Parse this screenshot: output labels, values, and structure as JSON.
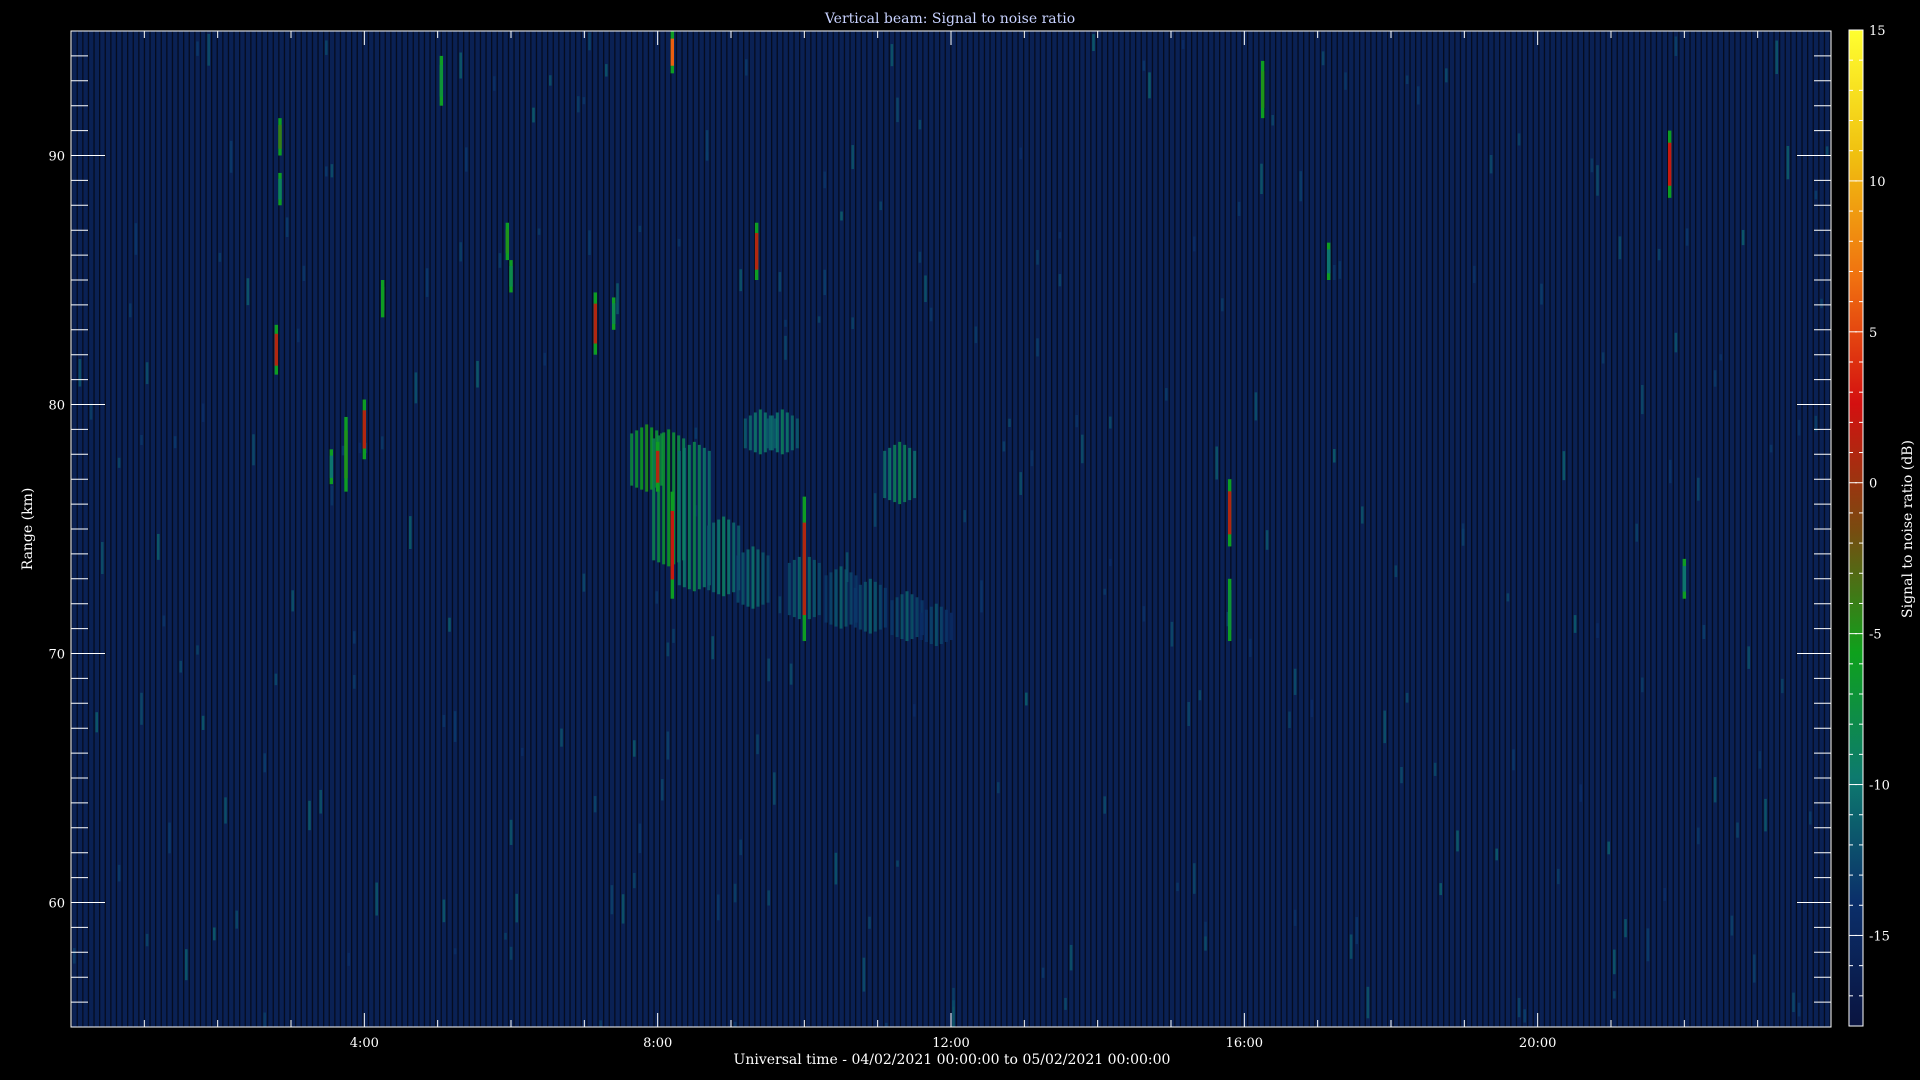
{
  "chart_data": {
    "type": "heatmap",
    "title": "Vertical beam: Signal to noise ratio",
    "xlabel": "Universal time - 04/02/2021 00:00:00 to 05/02/2021 00:00:00",
    "ylabel": "Range (km)",
    "x_unit": "hours UT",
    "xlim": [
      0,
      24
    ],
    "ylim": [
      55,
      95
    ],
    "x_ticks": [
      {
        "value": 4,
        "label": "4:00"
      },
      {
        "value": 8,
        "label": "8:00"
      },
      {
        "value": 12,
        "label": "12:00"
      },
      {
        "value": 16,
        "label": "16:00"
      },
      {
        "value": 20,
        "label": "20:00"
      }
    ],
    "y_ticks": [
      {
        "value": 60,
        "label": "60"
      },
      {
        "value": 70,
        "label": "70"
      },
      {
        "value": 80,
        "label": "80"
      },
      {
        "value": 90,
        "label": "90"
      }
    ],
    "colorbar": {
      "label": "Signal to noise ratio (dB)",
      "range": [
        -18,
        15
      ],
      "ticks": [
        {
          "value": 15,
          "label": "15"
        },
        {
          "value": 10,
          "label": "10"
        },
        {
          "value": 5,
          "label": "5"
        },
        {
          "value": 0,
          "label": "0"
        },
        {
          "value": -5,
          "label": "-5"
        },
        {
          "value": -10,
          "label": "-10"
        },
        {
          "value": -15,
          "label": "-15"
        }
      ],
      "colormap": [
        "#0a1440",
        "#0b2f6a",
        "#0d7a6e",
        "#0ea11c",
        "#7a4a10",
        "#d41010",
        "#f07010",
        "#f0c010",
        "#ffff30"
      ]
    },
    "background_snr_db": -16,
    "features": [
      {
        "t": 2.85,
        "r0": 90,
        "r1": 91.5,
        "snr": -4
      },
      {
        "t": 2.85,
        "r0": 88,
        "r1": 89.3,
        "snr": -9
      },
      {
        "t": 2.8,
        "r0": 81.2,
        "r1": 83.2,
        "snr": 1
      },
      {
        "t": 3.75,
        "r0": 76.5,
        "r1": 79.5,
        "snr": -5
      },
      {
        "t": 3.55,
        "r0": 76.8,
        "r1": 78.2,
        "snr": -10
      },
      {
        "t": 4.0,
        "r0": 77.8,
        "r1": 80.2,
        "snr": 1
      },
      {
        "t": 4.25,
        "r0": 83.5,
        "r1": 85,
        "snr": -6
      },
      {
        "t": 5.05,
        "r0": 92,
        "r1": 94,
        "snr": -7
      },
      {
        "t": 5.95,
        "r0": 85.8,
        "r1": 87.3,
        "snr": -5
      },
      {
        "t": 6.0,
        "r0": 84.5,
        "r1": 85.8,
        "snr": -8
      },
      {
        "t": 7.15,
        "r0": 82,
        "r1": 84.5,
        "snr": 1
      },
      {
        "t": 7.4,
        "r0": 83,
        "r1": 84.3,
        "snr": -8
      },
      {
        "t": 8.2,
        "r0": 93.3,
        "r1": 95,
        "snr": 6
      },
      {
        "t": 9.35,
        "r0": 85,
        "r1": 87.3,
        "snr": 1
      },
      {
        "t": 8.2,
        "r0": 72.2,
        "r1": 76.5,
        "snr": 2
      },
      {
        "t": 8.0,
        "r0": 76.5,
        "r1": 78.5,
        "snr": 1
      },
      {
        "t": 10.0,
        "r0": 70.5,
        "r1": 76.3,
        "snr": 1
      },
      {
        "t": 15.8,
        "r0": 74.3,
        "r1": 77,
        "snr": 1
      },
      {
        "t": 15.8,
        "r0": 70.5,
        "r1": 73,
        "snr": -7
      },
      {
        "t": 16.25,
        "r0": 91.5,
        "r1": 93.8,
        "snr": -5
      },
      {
        "t": 21.8,
        "r0": 88.3,
        "r1": 91,
        "snr": 2
      },
      {
        "t": 17.15,
        "r0": 85,
        "r1": 86.5,
        "snr": -10
      },
      {
        "t": 22.0,
        "r0": 72.2,
        "r1": 73.8,
        "snr": -10
      }
    ],
    "echo_layer": [
      {
        "t": 7.85,
        "r0": 76.5,
        "r1": 79.2,
        "snr": -5
      },
      {
        "t": 8.15,
        "r0": 73.5,
        "r1": 79,
        "snr": -6
      },
      {
        "t": 8.5,
        "r0": 72.5,
        "r1": 78.5,
        "snr": -8
      },
      {
        "t": 8.9,
        "r0": 72.3,
        "r1": 75.5,
        "snr": -9
      },
      {
        "t": 9.3,
        "r0": 71.8,
        "r1": 74.3,
        "snr": -10
      },
      {
        "t": 9.4,
        "r0": 78,
        "r1": 79.8,
        "snr": -9
      },
      {
        "t": 9.7,
        "r0": 78,
        "r1": 79.8,
        "snr": -9
      },
      {
        "t": 10.0,
        "r0": 71.3,
        "r1": 74,
        "snr": -10
      },
      {
        "t": 10.5,
        "r0": 71,
        "r1": 73.5,
        "snr": -11
      },
      {
        "t": 10.9,
        "r0": 70.8,
        "r1": 73,
        "snr": -11
      },
      {
        "t": 11.3,
        "r0": 76,
        "r1": 78.5,
        "snr": -8
      },
      {
        "t": 11.4,
        "r0": 70.5,
        "r1": 72.5,
        "snr": -11
      },
      {
        "t": 11.8,
        "r0": 70.3,
        "r1": 72,
        "snr": -12
      }
    ]
  }
}
